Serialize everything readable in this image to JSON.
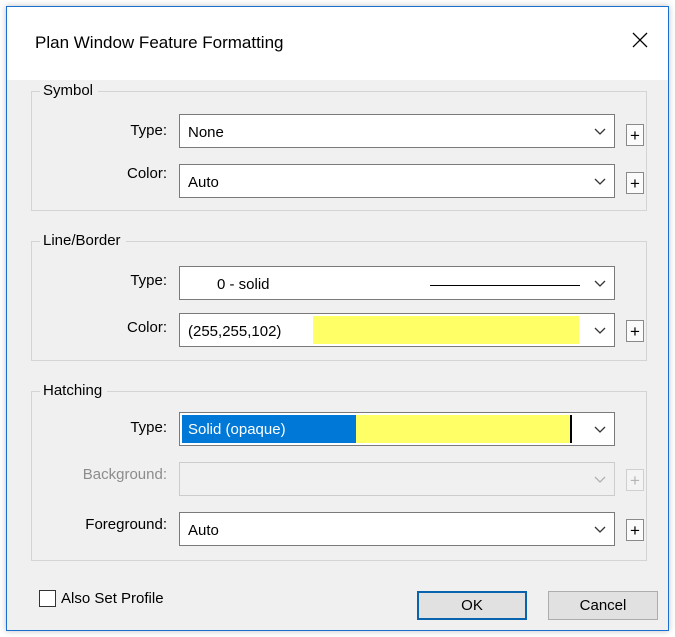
{
  "dialog": {
    "title": "Plan Window Feature Formatting"
  },
  "symbol": {
    "legend": "Symbol",
    "type_label": "Type:",
    "type_value": "None",
    "color_label": "Color:",
    "color_value": "Auto"
  },
  "line_border": {
    "legend": "Line/Border",
    "type_label": "Type:",
    "type_value": "0 - solid",
    "color_label": "Color:",
    "color_value": "(255,255,102)",
    "color_swatch": "#ffff66"
  },
  "hatching": {
    "legend": "Hatching",
    "type_label": "Type:",
    "type_value": "Solid (opaque)",
    "type_swatch": "#ffff66",
    "background_label": "Background:",
    "background_value": "",
    "foreground_label": "Foreground:",
    "foreground_value": "Auto"
  },
  "footer": {
    "also_set_profile_label": "Also Set Profile",
    "also_set_profile_checked": false,
    "ok_label": "OK",
    "cancel_label": "Cancel"
  },
  "plus_symbol": "+",
  "colors": {
    "selection_highlight": "#0078d7",
    "accent_border": "#1a6fd0"
  }
}
